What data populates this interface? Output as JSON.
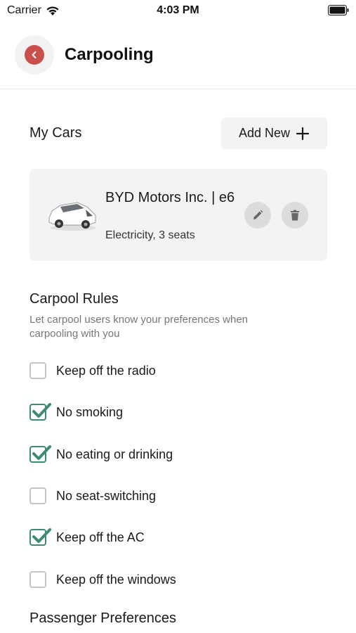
{
  "status_bar": {
    "carrier": "Carrier",
    "time": "4:03 PM"
  },
  "header": {
    "title": "Carpooling"
  },
  "my_cars": {
    "heading": "My Cars",
    "add_new_label": "Add New",
    "car": {
      "name": "BYD Motors Inc. | e6",
      "details": "Electricity, 3 seats"
    }
  },
  "carpool_rules": {
    "heading": "Carpool Rules",
    "description": "Let carpool users know your preferences when carpooling with you",
    "rules": [
      {
        "label": "Keep off the radio",
        "checked": false
      },
      {
        "label": "No smoking",
        "checked": true
      },
      {
        "label": "No eating or drinking",
        "checked": true
      },
      {
        "label": "No seat-switching",
        "checked": false
      },
      {
        "label": "Keep off the AC",
        "checked": true
      },
      {
        "label": "Keep off the windows",
        "checked": false
      }
    ]
  },
  "passenger_preferences": {
    "heading": "Passenger Preferences"
  },
  "colors": {
    "accent_red": "#c9504b",
    "check_green": "#3f8a73",
    "card_bg": "#f2f3f4"
  }
}
